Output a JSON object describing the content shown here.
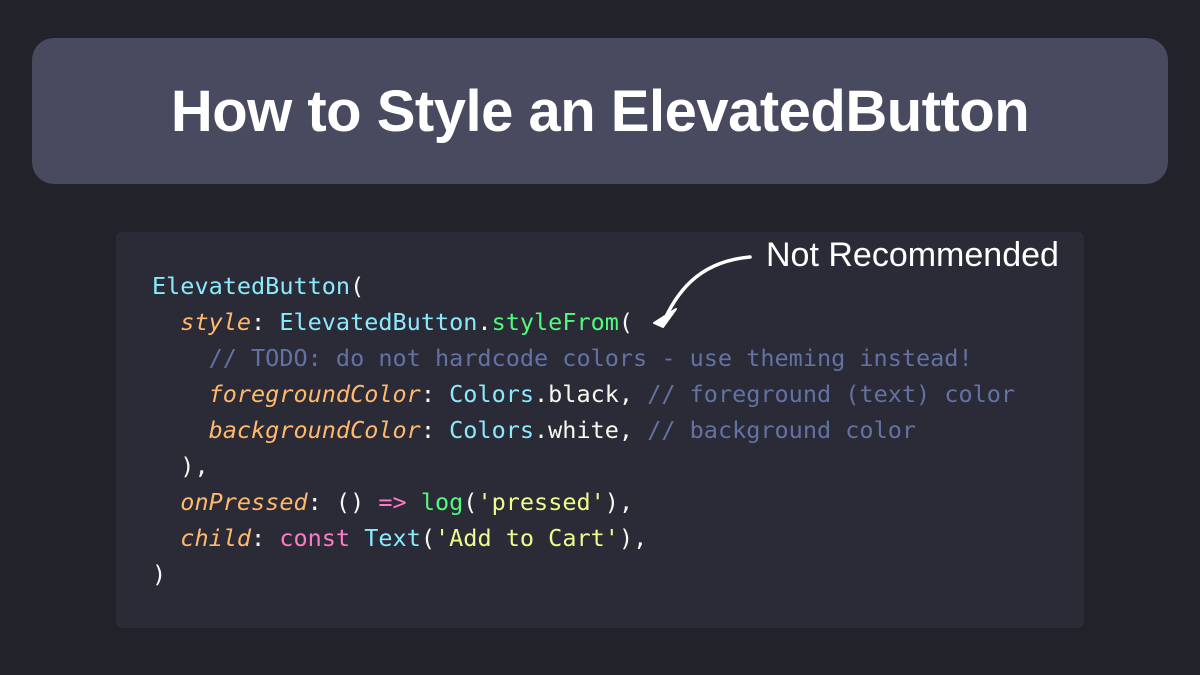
{
  "title": "How to Style an ElevatedButton",
  "annotation": {
    "label": "Not Recommended"
  },
  "colors": {
    "background": "#22222b",
    "banner": "#484a5f",
    "code_panel": "#2a2b36",
    "class_token": "#8be9fd",
    "function_token": "#50fa7b",
    "parameter_token": "#ffb86c",
    "comment_token": "#6272a4",
    "string_token": "#f1fa8c",
    "keyword_token": "#ff79c6",
    "plain_token": "#f8f8f2"
  },
  "code": {
    "lines": [
      [
        {
          "t": "ElevatedButton",
          "k": "cls"
        },
        {
          "t": "(",
          "k": "plain"
        }
      ],
      [
        {
          "t": "  ",
          "k": "plain"
        },
        {
          "t": "style",
          "k": "param"
        },
        {
          "t": ": ",
          "k": "plain"
        },
        {
          "t": "ElevatedButton",
          "k": "cls"
        },
        {
          "t": ".",
          "k": "plain"
        },
        {
          "t": "styleFrom",
          "k": "fn"
        },
        {
          "t": "(",
          "k": "plain"
        }
      ],
      [
        {
          "t": "    ",
          "k": "plain"
        },
        {
          "t": "// TODO: do not hardcode colors - use theming instead!",
          "k": "cmt"
        }
      ],
      [
        {
          "t": "    ",
          "k": "plain"
        },
        {
          "t": "foregroundColor",
          "k": "param"
        },
        {
          "t": ": ",
          "k": "plain"
        },
        {
          "t": "Colors",
          "k": "cls"
        },
        {
          "t": ".black, ",
          "k": "plain"
        },
        {
          "t": "// foreground (text) color",
          "k": "cmt"
        }
      ],
      [
        {
          "t": "    ",
          "k": "plain"
        },
        {
          "t": "backgroundColor",
          "k": "param"
        },
        {
          "t": ": ",
          "k": "plain"
        },
        {
          "t": "Colors",
          "k": "cls"
        },
        {
          "t": ".white, ",
          "k": "plain"
        },
        {
          "t": "// background color",
          "k": "cmt"
        }
      ],
      [
        {
          "t": "  ),",
          "k": "plain"
        }
      ],
      [
        {
          "t": "  ",
          "k": "plain"
        },
        {
          "t": "onPressed",
          "k": "param"
        },
        {
          "t": ": () ",
          "k": "plain"
        },
        {
          "t": "=>",
          "k": "kw"
        },
        {
          "t": " ",
          "k": "plain"
        },
        {
          "t": "log",
          "k": "fn"
        },
        {
          "t": "(",
          "k": "plain"
        },
        {
          "t": "'pressed'",
          "k": "str"
        },
        {
          "t": "),",
          "k": "plain"
        }
      ],
      [
        {
          "t": "  ",
          "k": "plain"
        },
        {
          "t": "child",
          "k": "param"
        },
        {
          "t": ": ",
          "k": "plain"
        },
        {
          "t": "const",
          "k": "kw"
        },
        {
          "t": " ",
          "k": "plain"
        },
        {
          "t": "Text",
          "k": "cls"
        },
        {
          "t": "(",
          "k": "plain"
        },
        {
          "t": "'Add to Cart'",
          "k": "str"
        },
        {
          "t": "),",
          "k": "plain"
        }
      ],
      [
        {
          "t": ")",
          "k": "plain"
        }
      ]
    ]
  }
}
